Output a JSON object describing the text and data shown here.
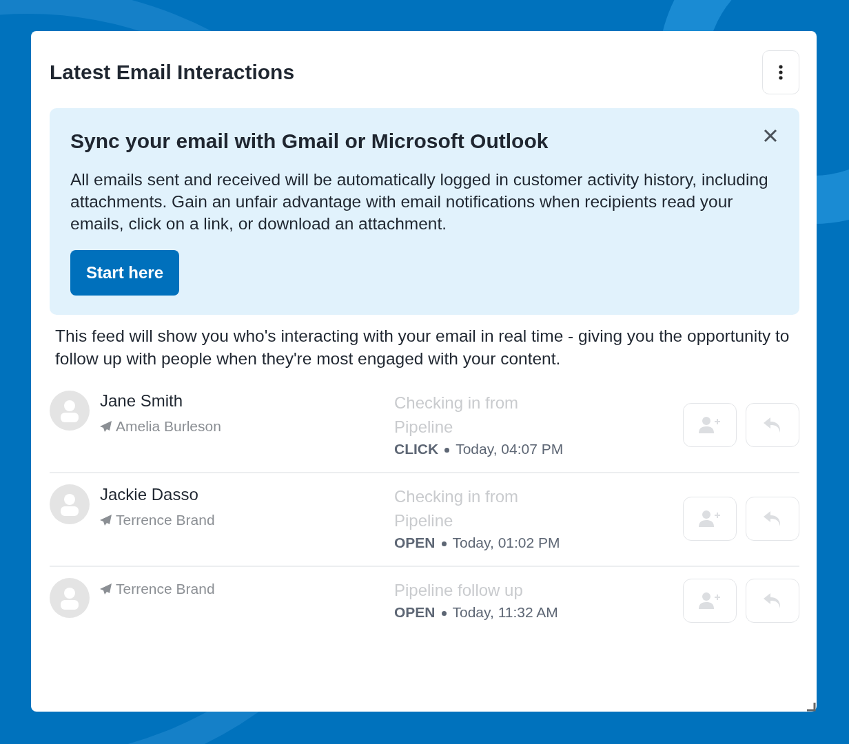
{
  "card": {
    "title": "Latest Email Interactions"
  },
  "banner": {
    "heading": "Sync your email with Gmail or Microsoft Outlook",
    "body": "All emails sent and received will be automatically logged in customer activity history, including attachments. Gain an unfair advantage with email notifications when recipients read your emails, click on a link, or download an attachment.",
    "button": "Start here"
  },
  "intro": "This feed will show you who's interacting with your email in real time - giving you the opportunity to follow up with people when they're most engaged with your content.",
  "interactions": [
    {
      "name": "Jane Smith",
      "sender": "Amelia Burleson",
      "subject": "Checking in from Pipeline",
      "event": "CLICK",
      "time": "Today, 04:07 PM"
    },
    {
      "name": "Jackie Dasso",
      "sender": "Terrence Brand",
      "subject": "Checking in from Pipeline",
      "event": "OPEN",
      "time": "Today, 01:02 PM"
    },
    {
      "sender": "Terrence Brand",
      "subject": "Pipeline follow up",
      "event": "OPEN",
      "time": "Today, 11:32 AM"
    }
  ]
}
